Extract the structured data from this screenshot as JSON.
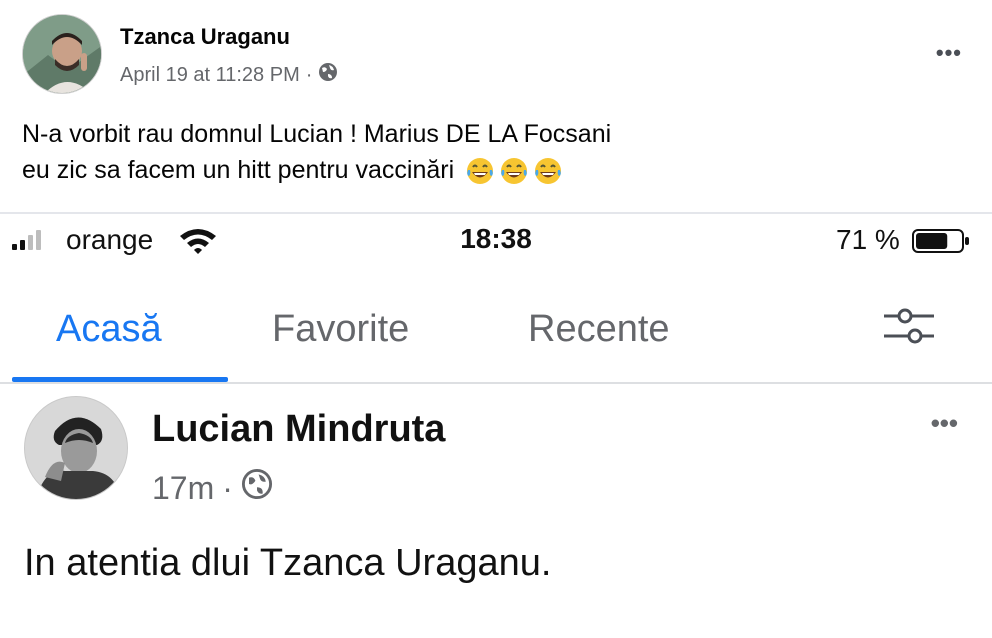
{
  "outer_post": {
    "author": "Tzanca Uraganu",
    "timestamp": "April 19 at 11:28 PM",
    "separator": "·",
    "more_label": "•••",
    "text_line1": "N-a vorbit rau domnul Lucian ! Marius DE LA Focsani",
    "text_line2": "eu zic sa facem un hitt pentru vaccinări",
    "emojis": [
      "face-with-tears-of-joy",
      "face-with-tears-of-joy",
      "face-with-tears-of-joy"
    ],
    "icon": "globe-icon"
  },
  "status_bar": {
    "carrier": "orange",
    "time": "18:38",
    "battery": "71 %",
    "battery_level": 0.71
  },
  "tabs": [
    {
      "label": "Acasă",
      "active": true
    },
    {
      "label": "Favorite",
      "active": false
    },
    {
      "label": "Recente",
      "active": false
    }
  ],
  "inner_post": {
    "author": "Lucian Mindruta",
    "time": "17m",
    "separator": "·",
    "more_label": "•••",
    "text": "In atentia dlui Tzanca Uraganu."
  },
  "colors": {
    "accent": "#1877f2",
    "secondary_text": "#65676b"
  }
}
